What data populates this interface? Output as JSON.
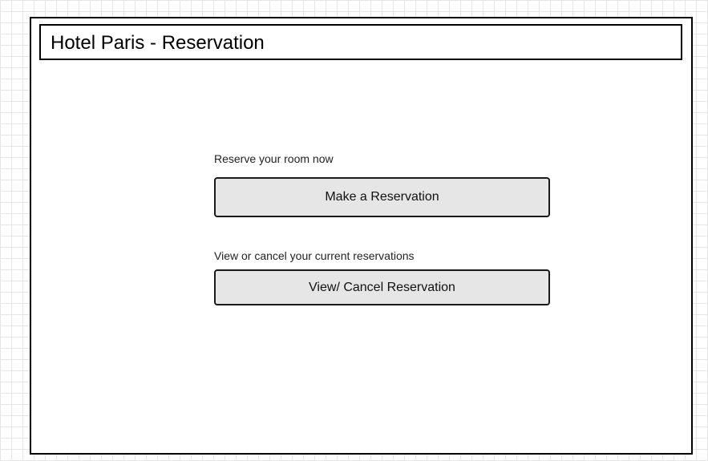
{
  "header": {
    "title": "Hotel Paris - Reservation"
  },
  "reserve_section": {
    "label": "Reserve your room now",
    "button_label": "Make a Reservation"
  },
  "view_section": {
    "label": "View or cancel your current reservations",
    "button_label": "View/ Cancel Reservation"
  },
  "colors": {
    "button_background": "#e6e6e6",
    "border": "#000000",
    "canvas_grid": "#e6e6e6"
  }
}
